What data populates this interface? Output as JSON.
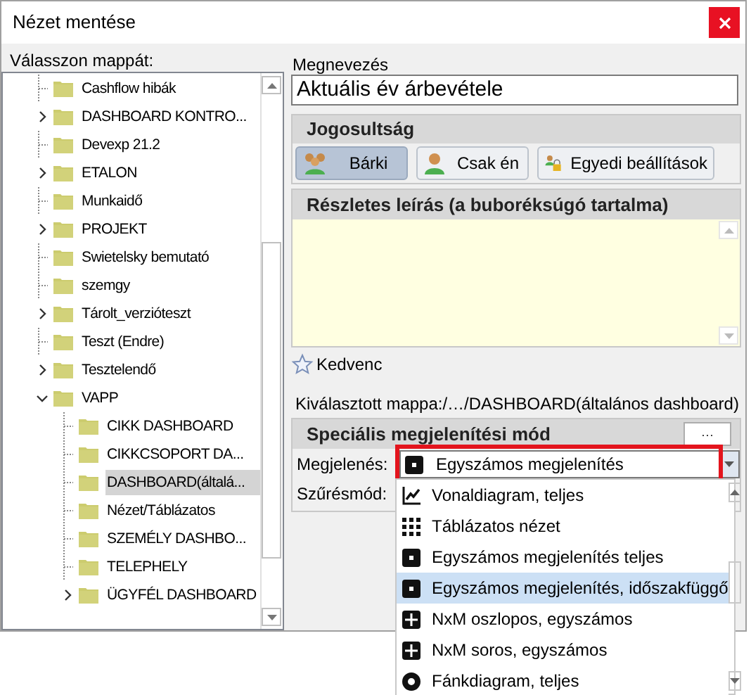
{
  "window": {
    "title": "Nézet mentése"
  },
  "folder_tree": {
    "label": "Válasszon mappát:",
    "items": [
      {
        "label": "Cashflow hibák",
        "expandable": false,
        "selected": false
      },
      {
        "label": "DASHBOARD KONTRO...",
        "expandable": true,
        "expanded": false,
        "selected": false
      },
      {
        "label": "Devexp 21.2",
        "expandable": false,
        "selected": false
      },
      {
        "label": "ETALON",
        "expandable": true,
        "expanded": false,
        "selected": false
      },
      {
        "label": "Munkaidő",
        "expandable": false,
        "selected": false
      },
      {
        "label": "PROJEKT",
        "expandable": true,
        "expanded": false,
        "selected": false
      },
      {
        "label": "Swietelsky bemutató",
        "expandable": false,
        "selected": false
      },
      {
        "label": "szemgy",
        "expandable": false,
        "selected": false
      },
      {
        "label": "Tárolt_verzióteszt",
        "expandable": true,
        "expanded": false,
        "selected": false
      },
      {
        "label": "Teszt (Endre)",
        "expandable": false,
        "selected": false
      },
      {
        "label": "Tesztelendő",
        "expandable": true,
        "expanded": false,
        "selected": false
      },
      {
        "label": "VAPP",
        "expandable": true,
        "expanded": true,
        "selected": false,
        "children": [
          {
            "label": "CIKK DASHBOARD",
            "expandable": false,
            "selected": false
          },
          {
            "label": "CIKKCSOPORT DA...",
            "expandable": false,
            "selected": false
          },
          {
            "label": "DASHBOARD(általá...",
            "expandable": false,
            "selected": true
          },
          {
            "label": "Nézet/Táblázatos",
            "expandable": false,
            "selected": false
          },
          {
            "label": "SZEMÉLY DASHBO...",
            "expandable": false,
            "selected": false
          },
          {
            "label": "TELEPHELY",
            "expandable": false,
            "selected": false
          },
          {
            "label": "ÜGYFÉL DASHBOARD",
            "expandable": true,
            "expanded": false,
            "selected": false
          }
        ]
      }
    ]
  },
  "name_field": {
    "label": "Megnevezés",
    "value": "Aktuális év árbevétele"
  },
  "permission": {
    "title": "Jogosultság",
    "options": [
      {
        "label": "Bárki",
        "kind": "group",
        "selected": true
      },
      {
        "label": "Csak én",
        "kind": "person",
        "selected": false
      },
      {
        "label": "Egyedi beállítások",
        "kind": "lock",
        "selected": false
      }
    ]
  },
  "description": {
    "title": "Részletes leírás (a buboréksúgó tartalma)"
  },
  "favorite": {
    "label": "Kedvenc",
    "checked": false
  },
  "selected_folder": "Kiválasztott mappa:/…/DASHBOARD(általános dashboard)",
  "special_mode": {
    "title": "Speciális megjelenítési mód",
    "more_button": "···",
    "display_label": "Megjelenés:",
    "display_value": "Egyszámos megjelenítés",
    "filter_label": "Szűrésmód:",
    "options": [
      {
        "label": "Vonaldiagram, teljes",
        "kind": "line",
        "selected": false
      },
      {
        "label": "Táblázatos nézet",
        "kind": "table",
        "selected": false
      },
      {
        "label": "Egyszámos megjelenítés teljes",
        "kind": "single",
        "selected": false
      },
      {
        "label": "Egyszámos megjelenítés, időszakfüggő",
        "kind": "single",
        "selected": true
      },
      {
        "label": "NxM oszlopos, egyszámos",
        "kind": "grid",
        "selected": false
      },
      {
        "label": "NxM soros, egyszámos",
        "kind": "grid",
        "selected": false
      },
      {
        "label": "Fánkdiagram, teljes",
        "kind": "donut",
        "selected": false
      }
    ]
  }
}
